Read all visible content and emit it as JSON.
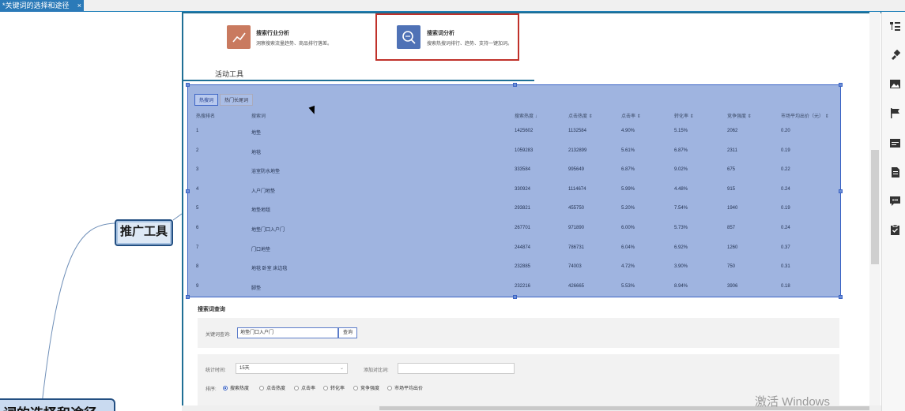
{
  "tab": {
    "title": "*关键词的选择和途径",
    "close": "×"
  },
  "mindmap": {
    "main_node": "推广工具",
    "root_node": "词的选择和途径"
  },
  "cards": [
    {
      "title": "搜索行业分析",
      "desc": "洞察搜索流量趋势、商品排行落差。",
      "color": "#c97a5f"
    },
    {
      "title": "搜索词分析",
      "desc": "搜索热搜词排行、趋势、支持一键加词。",
      "color": "#4f72b6"
    }
  ],
  "section_title": "活动工具",
  "table_tabs": [
    "热搜词",
    "热门长尾词"
  ],
  "columns": [
    "热搜排名",
    "搜索词",
    "搜索热度 ↓",
    "点击热度 ⇕",
    "点击率 ⇕",
    "转化率 ⇕",
    "竞争强度 ⇕",
    "市场平均出价（元） ⇕"
  ],
  "rows": [
    [
      "1",
      "地垫",
      "1425602",
      "1132584",
      "4.90%",
      "5.15%",
      "2062",
      "0.20"
    ],
    [
      "2",
      "地毯",
      "1059283",
      "2132899",
      "5.61%",
      "6.87%",
      "2311",
      "0.19"
    ],
    [
      "3",
      "浴室防水地垫",
      "333584",
      "995649",
      "6.87%",
      "9.02%",
      "675",
      "0.22"
    ],
    [
      "4",
      "入户门地垫",
      "330924",
      "1114674",
      "5.99%",
      "4.48%",
      "915",
      "0.24"
    ],
    [
      "5",
      "地垫地毯",
      "293821",
      "455750",
      "5.20%",
      "7.54%",
      "1940",
      "0.19"
    ],
    [
      "6",
      "地垫门口入户门",
      "267701",
      "971890",
      "6.00%",
      "5.73%",
      "857",
      "0.24"
    ],
    [
      "7",
      "门口地垫",
      "244874",
      "786731",
      "6.04%",
      "6.92%",
      "1260",
      "0.37"
    ],
    [
      "8",
      "地毯 卧室 床边毯",
      "232885",
      "74003",
      "4.72%",
      "3.90%",
      "750",
      "0.31"
    ],
    [
      "9",
      "脚垫",
      "232216",
      "426665",
      "5.53%",
      "8.94%",
      "3906",
      "0.18"
    ]
  ],
  "query": {
    "title": "搜索词查询",
    "keyword_label": "关键词查询:",
    "keyword_value": "地垫门口入户门",
    "search_button": "查询",
    "time_label": "统计时间:",
    "time_value": "15天",
    "add_label": "添加对比词:",
    "sort_label": "排序:",
    "sort_options": [
      "搜索热度",
      "点击热度",
      "点击率",
      "转化率",
      "竞争强度",
      "市场平均出价"
    ]
  },
  "watermark": "激活 Windows"
}
